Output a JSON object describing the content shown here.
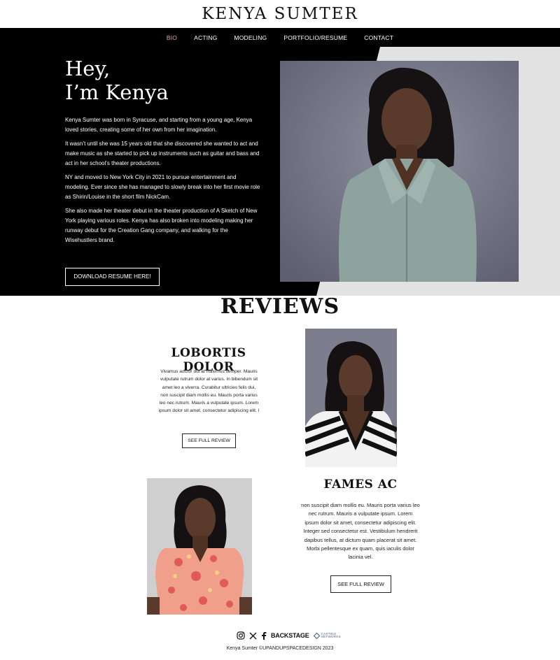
{
  "site": {
    "title": "KENYA SUMTER"
  },
  "nav": {
    "items": [
      {
        "label": "BIO",
        "active": true
      },
      {
        "label": "ACTING",
        "active": false
      },
      {
        "label": "MODELING",
        "active": false
      },
      {
        "label": "PORTFOLIO/RESUME",
        "active": false
      },
      {
        "label": "CONTACT",
        "active": false
      }
    ]
  },
  "hero": {
    "heading_line1": "Hey,",
    "heading_line2": "I’m Kenya",
    "bio": [
      "Kenya Sumter was born in Syracuse, and starting from a young age, Kenya loved stories, creating some of her own from her imagination.",
      "It wasn’t until she was 15 years old that she discovered she wanted to act and make music as she started to pick up instruments such as guitar and bass and act in her school’s theater productions.",
      "NY and moved to New York City in 2021 to pursue entertainment and modeling. Ever since she has managed to slowly break into her first movie role as Shirin/Louise in the short film NickCam.",
      "She also made her theater debut in the theater production of A Sketch of New York playing various roles. Kenya has also broken into modeling making her runway debut for the Creation Gang company, and walking for the Wisehustlers brand."
    ],
    "resume_button": "DOWNLOAD RESUME HERE!"
  },
  "reviews": {
    "title": "REVIEWS",
    "items": [
      {
        "heading": "LOBORTIS DOLOR",
        "text": "Vivamus auctor dui at maximus semper. Mauris vulputate rutrum dolor at varius. In bibendum sit amet leo a viverra. Curabitur ultricies felis dui, non suscipit diam mollis eu. Mauris porta varius leo nec rutrum. Mauris a vulputate ipsum. Lorem ipsum dolor sit amet, consectetur adipiscing elit. l",
        "button": "SEE FULL REVIEW"
      },
      {
        "heading": "FAMES AC",
        "text": "non suscipit diam mollis eu. Mauris porta varius leo nec rutrum. Mauris a vulputate ipsum. Lorem ipsum dolor sit amet, consectetur adipiscing elit. Integer sed consectetur est. Vestibulum hendrerit dapibus tellus, at dictum quam placerat sit amet. Morbi pellentesque ex quam, quis iaculis dolor lacinia vel.",
        "button": "SEE FULL REVIEW"
      }
    ]
  },
  "footer": {
    "icons": [
      "instagram-icon",
      "x-icon",
      "facebook-icon"
    ],
    "backstage_label": "BACKSTAGE",
    "casting_line1": "CASTING",
    "casting_line2": "NETWORKS",
    "copyright": "Kenya Sumter ©UPANDUPSPACEDESIGN 2023"
  },
  "colors": {
    "nav_background": "#000000",
    "nav_active": "#e8a3a0",
    "hero_background": "#000000",
    "hero_accent_gray": "#e2e2e2"
  }
}
